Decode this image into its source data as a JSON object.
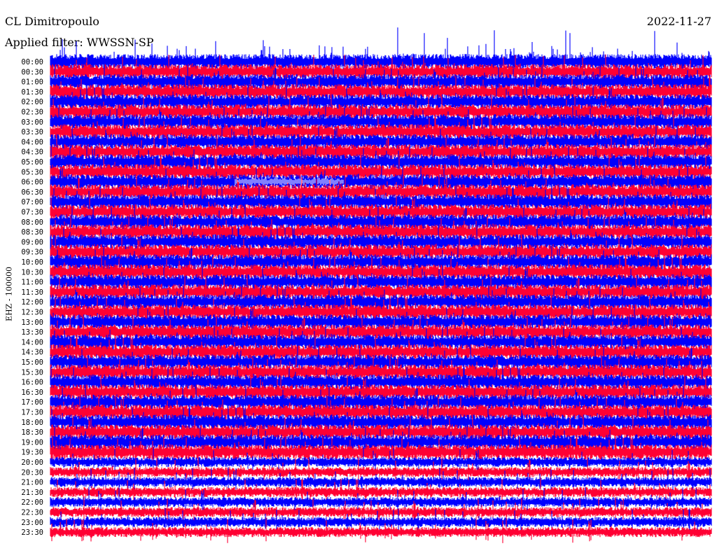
{
  "header": {
    "station": "CL Dimitropoulo",
    "filter_label": "Applied filter: WWSSN-SP",
    "date": "2022-11-27"
  },
  "chart_data": {
    "type": "line",
    "title": "CL Dimitropoulo",
    "subtitle": "Applied filter: WWSSN-SP",
    "date": "2022-11-27",
    "ylabel": "EHZ - 100000",
    "xlabel": "",
    "grid": false,
    "row_labels": [
      "00:00",
      "00:30",
      "01:00",
      "01:30",
      "02:00",
      "02:30",
      "03:00",
      "03:30",
      "04:00",
      "04:30",
      "05:00",
      "05:30",
      "06:00",
      "06:30",
      "07:00",
      "07:30",
      "08:00",
      "08:30",
      "09:00",
      "09:30",
      "10:00",
      "10:30",
      "11:00",
      "11:30",
      "12:00",
      "12:30",
      "13:00",
      "13:30",
      "14:00",
      "14:30",
      "15:00",
      "15:30",
      "16:00",
      "16:30",
      "17:00",
      "17:30",
      "18:00",
      "18:30",
      "19:00",
      "19:30",
      "20:00",
      "20:30",
      "21:00",
      "21:30",
      "22:00",
      "22:30",
      "23:00",
      "23:30"
    ],
    "row_minutes": 30,
    "colors": [
      "#0000ff",
      "#ff0033"
    ],
    "saturated_segment_label": "06:00"
  }
}
